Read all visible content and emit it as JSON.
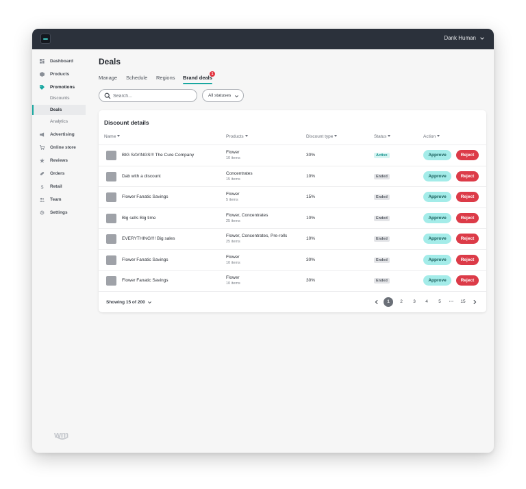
{
  "header": {
    "user_name": "Dank Human"
  },
  "sidebar": {
    "items": [
      {
        "label": "Dashboard",
        "icon": "dashboard-icon"
      },
      {
        "label": "Products",
        "icon": "products-icon"
      },
      {
        "label": "Promotions",
        "icon": "tag-icon"
      },
      {
        "label": "Advertising",
        "icon": "megaphone-icon"
      },
      {
        "label": "Online store",
        "icon": "cart-icon"
      },
      {
        "label": "Reviews",
        "icon": "star-icon"
      },
      {
        "label": "Orders",
        "icon": "pill-icon"
      },
      {
        "label": "Retail",
        "icon": "dollar-icon"
      },
      {
        "label": "Team",
        "icon": "team-icon"
      },
      {
        "label": "Settings",
        "icon": "gear-icon"
      }
    ],
    "sub_items": [
      {
        "label": "Discounts"
      },
      {
        "label": "Deals"
      },
      {
        "label": "Analytics"
      }
    ],
    "brand_mark": "wm"
  },
  "page": {
    "title": "Deals",
    "tabs": [
      {
        "label": "Manage"
      },
      {
        "label": "Schedule"
      },
      {
        "label": "Regions"
      },
      {
        "label": "Brand deals",
        "badge": "1"
      }
    ],
    "search": {
      "placeholder": "Search...",
      "value": ""
    },
    "status_filter": "All statuses"
  },
  "table": {
    "title": "Discount details",
    "columns": [
      "Name",
      "Products",
      "Discount type",
      "Status",
      "Action"
    ],
    "rows": [
      {
        "name": "BIG SAVINGS!!! The Cure Company",
        "products": "Flower",
        "items": "10 items",
        "discount": "30%",
        "status": "Active",
        "approve": "Approve",
        "reject": "Reject"
      },
      {
        "name": "Dab with a discount",
        "products": "Concentrates",
        "items": "15 items",
        "discount": "10%",
        "status": "Ended",
        "approve": "Approve",
        "reject": "Reject"
      },
      {
        "name": "Flower Fanatic Savings",
        "products": "Flower",
        "items": "5 items",
        "discount": "15%",
        "status": "Ended",
        "approve": "Approve",
        "reject": "Reject"
      },
      {
        "name": "Big sells Big time",
        "products": "Flower, Concentrates",
        "items": "25 items",
        "discount": "10%",
        "status": "Ended",
        "approve": "Approve",
        "reject": "Reject"
      },
      {
        "name": "EVERYTHING!!!! Big sales",
        "products": "Flower, Concentrates, Pre-rolls",
        "items": "25 items",
        "discount": "10%",
        "status": "Ended",
        "approve": "Approve",
        "reject": "Reject"
      },
      {
        "name": "Flower Fanatic Savings",
        "products": "Flower",
        "items": "10 items",
        "discount": "30%",
        "status": "Ended",
        "approve": "Approve",
        "reject": "Reject"
      },
      {
        "name": "Flower Fanatic Savings",
        "products": "Flower",
        "items": "10 items",
        "discount": "30%",
        "status": "Ended",
        "approve": "Approve",
        "reject": "Reject"
      }
    ],
    "footer": {
      "showing": "Showing 15 of 200",
      "pages": [
        "1",
        "2",
        "3",
        "4",
        "5",
        "15"
      ],
      "current_page": "1",
      "ellipsis": "···"
    }
  },
  "colors": {
    "accent": "#19a7a0",
    "topbar": "#2b313b",
    "approve_bg": "#a4ece9",
    "reject_bg": "#dc3b48",
    "badge_red": "#e3333f"
  }
}
